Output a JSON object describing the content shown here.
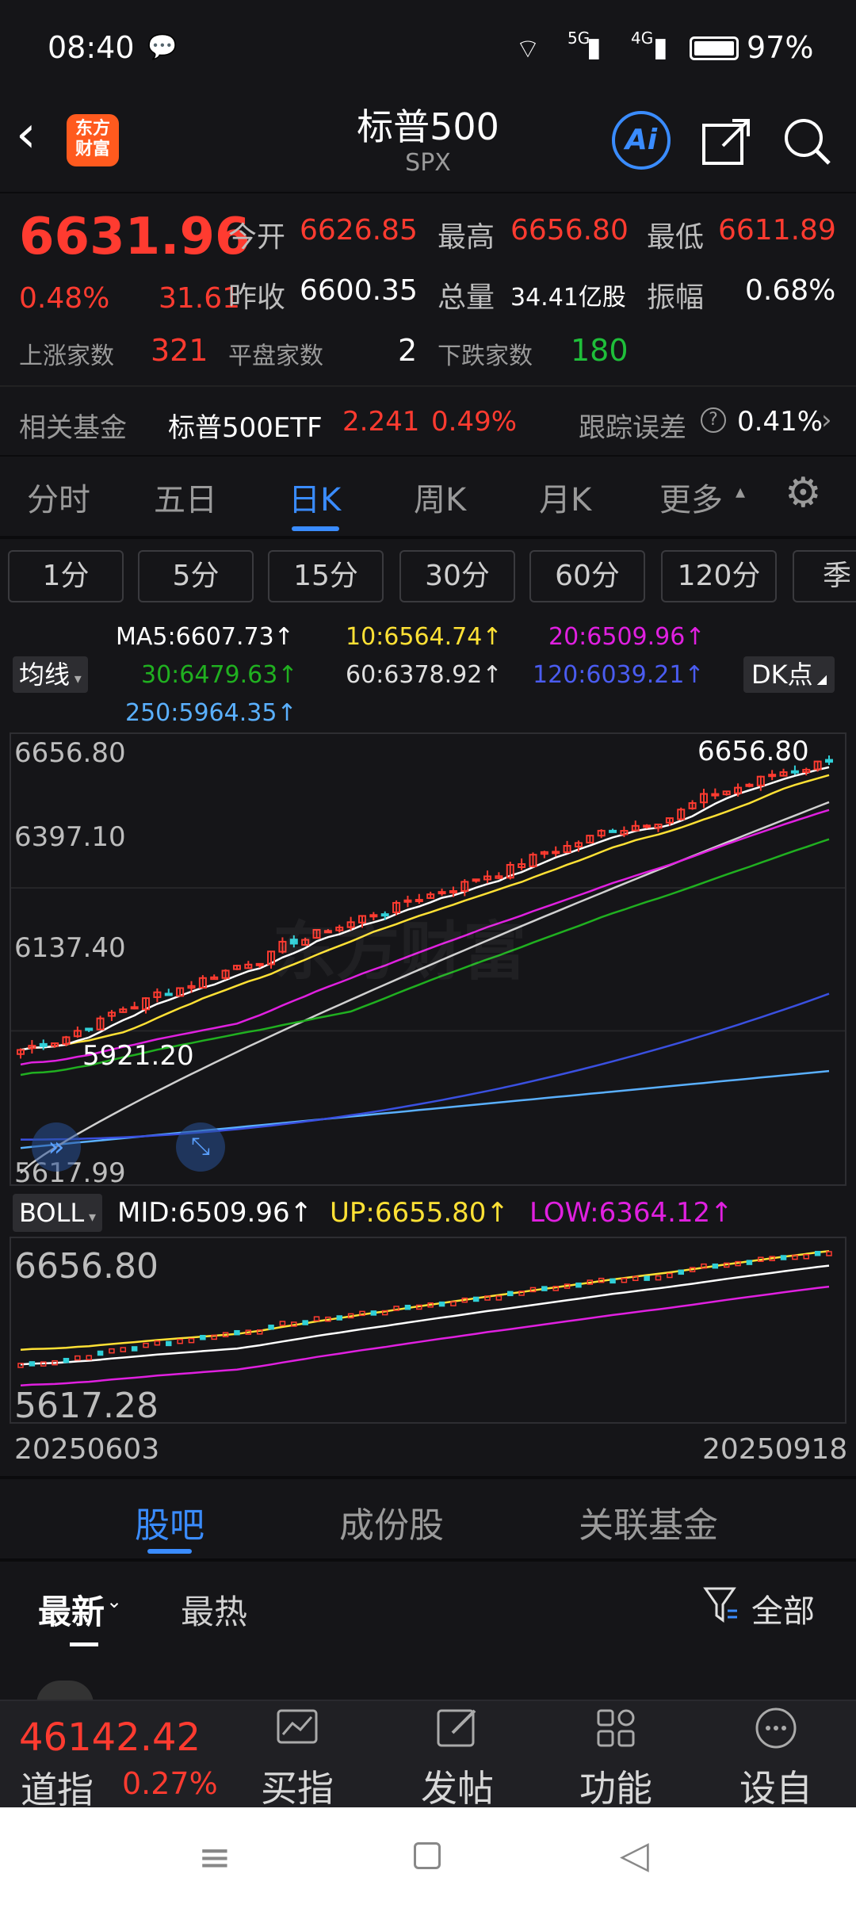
{
  "status": {
    "time": "08:40",
    "battery": "97%",
    "net1": "5G",
    "net2": "4G"
  },
  "header": {
    "title": "标普500",
    "subtitle": "SPX",
    "logo_line1": "东方",
    "logo_line2": "财富",
    "ai": "Ai"
  },
  "quote": {
    "price": "6631.96",
    "pct": "0.48%",
    "chg": "31.61",
    "open_label": "今开",
    "open": "6626.85",
    "high_label": "最高",
    "high": "6656.80",
    "low_label": "最低",
    "low": "6611.89",
    "prev_label": "昨收",
    "prev": "6600.35",
    "vol_label": "总量",
    "vol": "34.41亿股",
    "amp_label": "振幅",
    "amp": "0.68%",
    "up_label": "上涨家数",
    "up": "321",
    "flat_label": "平盘家数",
    "flat": "2",
    "down_label": "下跌家数",
    "down": "180"
  },
  "fund": {
    "label": "相关基金",
    "name": "标普500ETF",
    "price": "2.241",
    "pct": "0.49%",
    "track_label": "跟踪误差",
    "track": "0.41%"
  },
  "tabs": [
    "分时",
    "五日",
    "日K",
    "周K",
    "月K",
    "更多"
  ],
  "periods": [
    "1分",
    "5分",
    "15分",
    "30分",
    "60分",
    "120分",
    "季"
  ],
  "ma": {
    "selector": "均线",
    "ma5": "MA5:6607.73↑",
    "ma10": "10:6564.74↑",
    "ma20": "20:6509.96↑",
    "ma30": "30:6479.63↑",
    "ma60": "60:6378.92↑",
    "ma120": "120:6039.21↑",
    "ma250": "250:5964.35↑",
    "dk": "DK点"
  },
  "kchart": {
    "y_top": "6656.80",
    "y_mid1": "6397.10",
    "y_mid2": "6137.40",
    "y_bottom": "5617.99",
    "max_label": "6656.80",
    "min_label": "5921.20",
    "watermark": "东方财富"
  },
  "boll": {
    "selector": "BOLL",
    "mid": "MID:6509.96↑",
    "up": "UP:6655.80↑",
    "low": "LOW:6364.12↑",
    "y_top": "6656.80",
    "y_bottom": "5617.28",
    "date_start": "20250603",
    "date_end": "20250918"
  },
  "subtabs": [
    "股吧",
    "成份股",
    "关联基金"
  ],
  "filters": {
    "latest": "最新",
    "hot": "最热",
    "all": "全部"
  },
  "bottom": {
    "index_price": "46142.42",
    "index_name": "道指",
    "index_pct": "0.27%",
    "items": [
      "买指数",
      "发帖",
      "功能",
      "设自选"
    ]
  },
  "colors": {
    "up": "#ff3b30",
    "down": "#1fbf3a",
    "ma5": "#ffffff",
    "ma10": "#ffe135",
    "ma20": "#e020e0",
    "ma30": "#20b020",
    "ma60": "#d0d0d0",
    "ma120": "#3a50e0",
    "ma250": "#5ab0ff",
    "accent": "#3a8cff"
  }
}
